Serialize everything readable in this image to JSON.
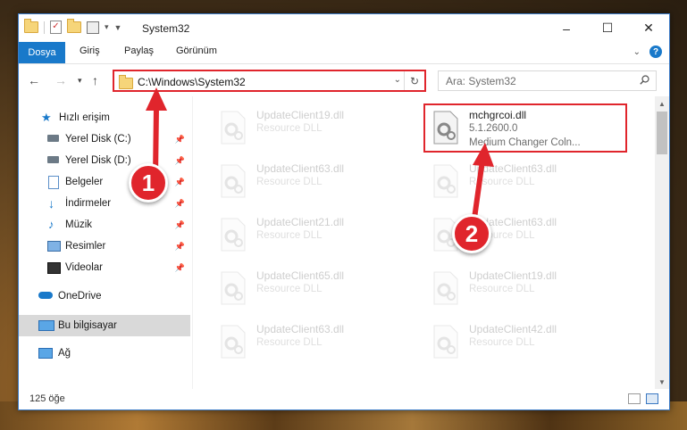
{
  "window": {
    "title": "System32",
    "controls": {
      "minimize": "–",
      "maximize": "☐",
      "close": "✕"
    }
  },
  "ribbon": {
    "tabs": [
      "Dosya",
      "Giriş",
      "Paylaş",
      "Görünüm"
    ],
    "active_tab": "Dosya",
    "help": "?"
  },
  "nav": {
    "address": "C:\\Windows\\System32",
    "search_placeholder": "Ara: System32"
  },
  "sidebar": {
    "items": [
      {
        "label": "Hızlı erişim",
        "icon": "star-icon",
        "pinned": false
      },
      {
        "label": "Yerel Disk (C:)",
        "icon": "drive-icon",
        "pinned": true
      },
      {
        "label": "Yerel Disk (D:)",
        "icon": "drive-icon",
        "pinned": true
      },
      {
        "label": "Belgeler",
        "icon": "documents-icon",
        "pinned": true
      },
      {
        "label": "İndirmeler",
        "icon": "download-icon",
        "pinned": true
      },
      {
        "label": "Müzik",
        "icon": "music-icon",
        "pinned": true
      },
      {
        "label": "Resimler",
        "icon": "pictures-icon",
        "pinned": true
      },
      {
        "label": "Videolar",
        "icon": "video-icon",
        "pinned": true
      },
      {
        "label": "OneDrive",
        "icon": "cloud-icon",
        "pinned": false
      },
      {
        "label": "Bu bilgisayar",
        "icon": "computer-icon",
        "pinned": false,
        "selected": true
      },
      {
        "label": "Ağ",
        "icon": "network-icon",
        "pinned": false
      }
    ]
  },
  "files": {
    "left": [
      {
        "name": "UpdateClient19.dll",
        "type": "Resource DLL"
      },
      {
        "name": "UpdateClient63.dll",
        "type": "Resource DLL"
      },
      {
        "name": "UpdateClient21.dll",
        "type": "Resource DLL"
      },
      {
        "name": "UpdateClient65.dll",
        "type": "Resource DLL"
      },
      {
        "name": "UpdateClient63.dll",
        "type": "Resource DLL"
      }
    ],
    "right": [
      {
        "name": "mchgrcoi.dll",
        "type": "5.1.2600.0",
        "desc": "Medium Changer Coln...",
        "highlighted": true
      },
      {
        "name": "UpdateClient63.dll",
        "type": "Resource DLL"
      },
      {
        "name": "UpdateClient63.dll",
        "type": "Resource DLL"
      },
      {
        "name": "UpdateClient19.dll",
        "type": "Resource DLL"
      },
      {
        "name": "UpdateClient42.dll",
        "type": "Resource DLL"
      }
    ]
  },
  "status": {
    "count": "125 öğe"
  },
  "annotations": [
    {
      "number": "1"
    },
    {
      "number": "2"
    }
  ],
  "colors": {
    "accent": "#1979ca",
    "annotation": "#e0252c"
  }
}
